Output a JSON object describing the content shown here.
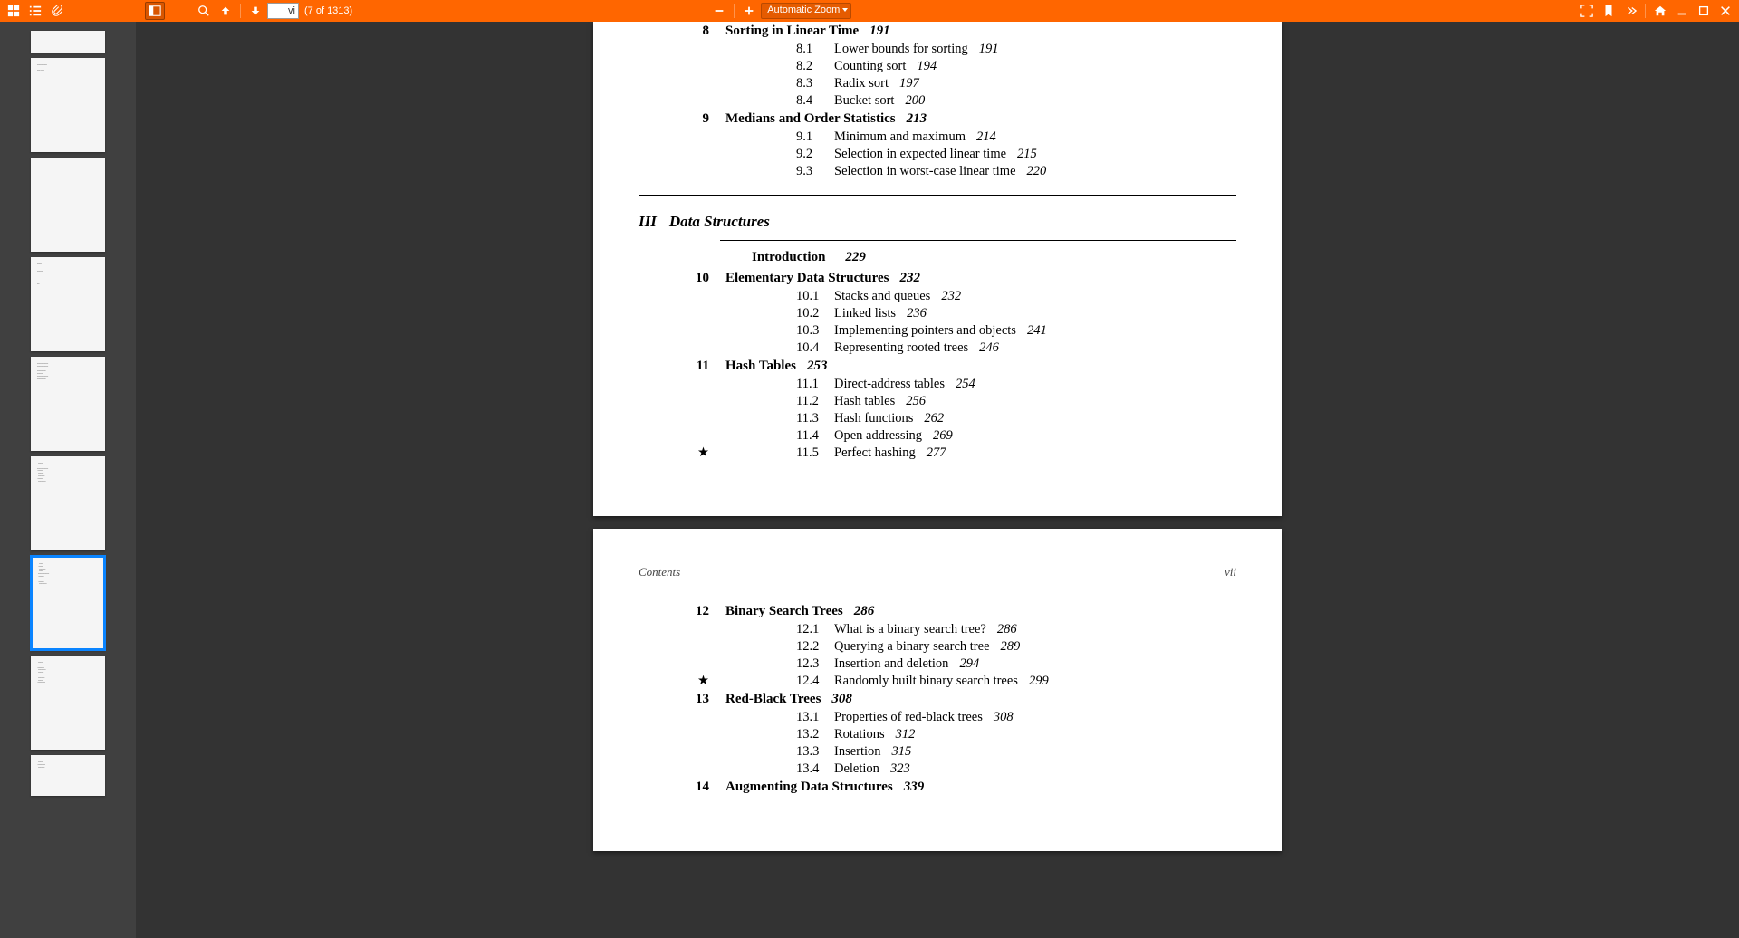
{
  "toolbar": {
    "page_input": "vi",
    "page_label": "(7 of 1313)",
    "zoom_label": "Automatic Zoom"
  },
  "doc": {
    "page1": {
      "chapters": [
        {
          "num": "8",
          "title": "Sorting in Linear Time",
          "pg": "191",
          "sections": [
            {
              "num": "8.1",
              "title": "Lower bounds for sorting",
              "pg": "191"
            },
            {
              "num": "8.2",
              "title": "Counting sort",
              "pg": "194"
            },
            {
              "num": "8.3",
              "title": "Radix sort",
              "pg": "197"
            },
            {
              "num": "8.4",
              "title": "Bucket sort",
              "pg": "200"
            }
          ]
        },
        {
          "num": "9",
          "title": "Medians and Order Statistics",
          "pg": "213",
          "sections": [
            {
              "num": "9.1",
              "title": "Minimum and maximum",
              "pg": "214"
            },
            {
              "num": "9.2",
              "title": "Selection in expected linear time",
              "pg": "215"
            },
            {
              "num": "9.3",
              "title": "Selection in worst-case linear time",
              "pg": "220"
            }
          ]
        }
      ],
      "part": {
        "num": "III",
        "title": "Data Structures"
      },
      "intro": {
        "title": "Introduction",
        "pg": "229"
      },
      "chapters2": [
        {
          "num": "10",
          "title": "Elementary Data Structures",
          "pg": "232",
          "sections": [
            {
              "num": "10.1",
              "title": "Stacks and queues",
              "pg": "232"
            },
            {
              "num": "10.2",
              "title": "Linked lists",
              "pg": "236"
            },
            {
              "num": "10.3",
              "title": "Implementing pointers and objects",
              "pg": "241"
            },
            {
              "num": "10.4",
              "title": "Representing rooted trees",
              "pg": "246"
            }
          ]
        },
        {
          "num": "11",
          "title": "Hash Tables",
          "pg": "253",
          "sections": [
            {
              "num": "11.1",
              "title": "Direct-address tables",
              "pg": "254"
            },
            {
              "num": "11.2",
              "title": "Hash tables",
              "pg": "256"
            },
            {
              "num": "11.3",
              "title": "Hash functions",
              "pg": "262"
            },
            {
              "num": "11.4",
              "title": "Open addressing",
              "pg": "269"
            },
            {
              "num": "11.5",
              "title": "Perfect hashing",
              "pg": "277",
              "star": true
            }
          ]
        }
      ]
    },
    "page2": {
      "hdr_left": "Contents",
      "hdr_right": "vii",
      "chapters": [
        {
          "num": "12",
          "title": "Binary Search Trees",
          "pg": "286",
          "sections": [
            {
              "num": "12.1",
              "title": "What is a binary search tree?",
              "pg": "286"
            },
            {
              "num": "12.2",
              "title": "Querying a binary search tree",
              "pg": "289"
            },
            {
              "num": "12.3",
              "title": "Insertion and deletion",
              "pg": "294"
            },
            {
              "num": "12.4",
              "title": "Randomly built binary search trees",
              "pg": "299",
              "star": true
            }
          ]
        },
        {
          "num": "13",
          "title": "Red-Black Trees",
          "pg": "308",
          "sections": [
            {
              "num": "13.1",
              "title": "Properties of red-black trees",
              "pg": "308"
            },
            {
              "num": "13.2",
              "title": "Rotations",
              "pg": "312"
            },
            {
              "num": "13.3",
              "title": "Insertion",
              "pg": "315"
            },
            {
              "num": "13.4",
              "title": "Deletion",
              "pg": "323"
            }
          ]
        },
        {
          "num": "14",
          "title": "Augmenting Data Structures",
          "pg": "339",
          "sections": []
        }
      ]
    }
  }
}
